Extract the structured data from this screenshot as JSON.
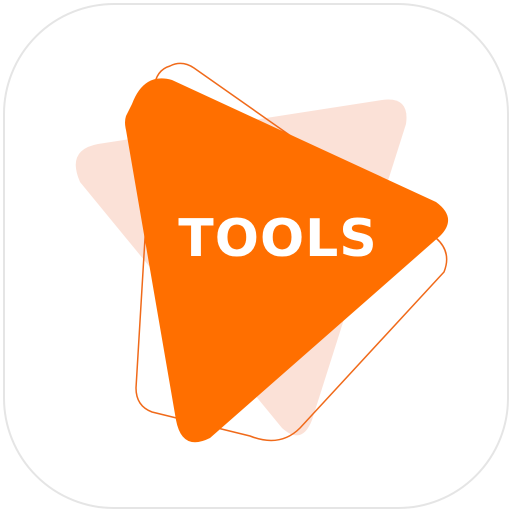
{
  "app_icon": {
    "label": "TOOLS",
    "icon_name": "play-tools-icon",
    "colors": {
      "primary": "#FF6F00",
      "secondary": "#FBE1D7",
      "outline": "#F06A1A",
      "background": "#FFFFFF",
      "border": "#E5E5E5"
    }
  }
}
